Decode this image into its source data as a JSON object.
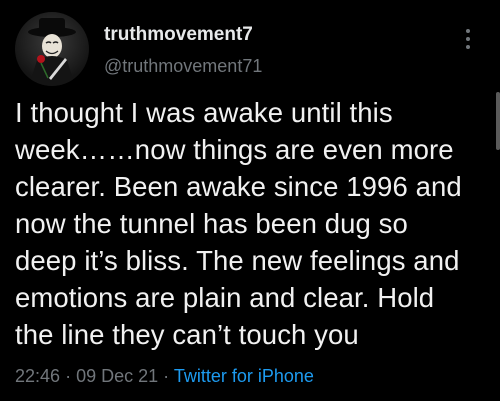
{
  "user": {
    "display_name": "truthmovement7",
    "handle": "@truthmovement71",
    "avatar_icon": "masked-figure-with-rose-avatar"
  },
  "menu": {
    "icon": "more-vertical-icon"
  },
  "tweet": {
    "lines": [
      "I thought I was awake until this",
      "week……now things are even more",
      "clearer. Been awake since 1996 and",
      "now the tunnel has been dug so",
      "deep it’s bliss. The new feelings and",
      "emotions are plain and clear. Hold",
      "the line they can’t touch you"
    ]
  },
  "meta": {
    "time": "22:46",
    "separator": "·",
    "date": "09 Dec 21",
    "source": "Twitter for iPhone"
  },
  "colors": {
    "background": "#000000",
    "text": "#e7e9ea",
    "secondary": "#71767b",
    "link": "#1d9bf0"
  }
}
